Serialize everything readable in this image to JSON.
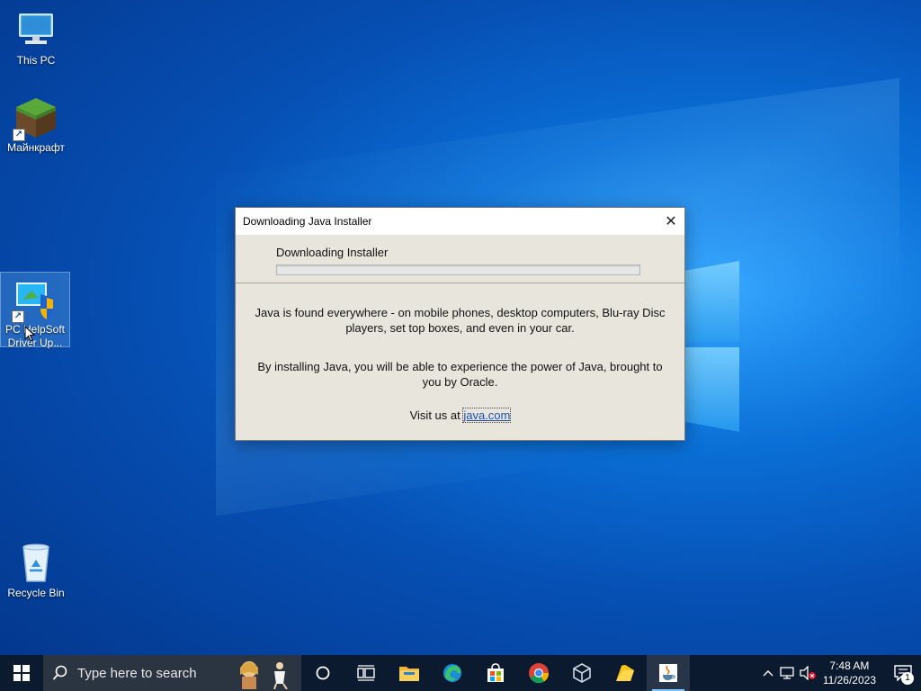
{
  "desktop": {
    "icons": [
      {
        "label": "This PC"
      },
      {
        "label": "Майнкрафт"
      },
      {
        "label": "PC HelpSoft Driver Up..."
      },
      {
        "label": "Recycle Bin"
      }
    ]
  },
  "dialog": {
    "title": "Downloading Java Installer",
    "status": "Downloading Installer",
    "progress": 0,
    "paragraph1": "Java is found everywhere - on mobile phones, desktop computers, Blu-ray Disc players, set top boxes, and even in your car.",
    "paragraph2": "By installing Java, you will be able to experience the power of Java, brought to you by Oracle.",
    "visit_prefix": "Visit us at ",
    "visit_link": "java.com",
    "close_glyph": "✕"
  },
  "taskbar": {
    "search_placeholder": "Type here to search",
    "apps": [
      "task-view",
      "file-explorer",
      "edge",
      "microsoft-store",
      "chrome",
      "virtualbox",
      "sticky-folder",
      "java-installer"
    ],
    "clock_time": "7:48 AM",
    "clock_date": "11/26/2023",
    "notification_count": "1"
  },
  "colors": {
    "desktop_accent": "#0a6fd6",
    "taskbar_bg": "#0b1a2f",
    "link": "#1c4fb4"
  }
}
